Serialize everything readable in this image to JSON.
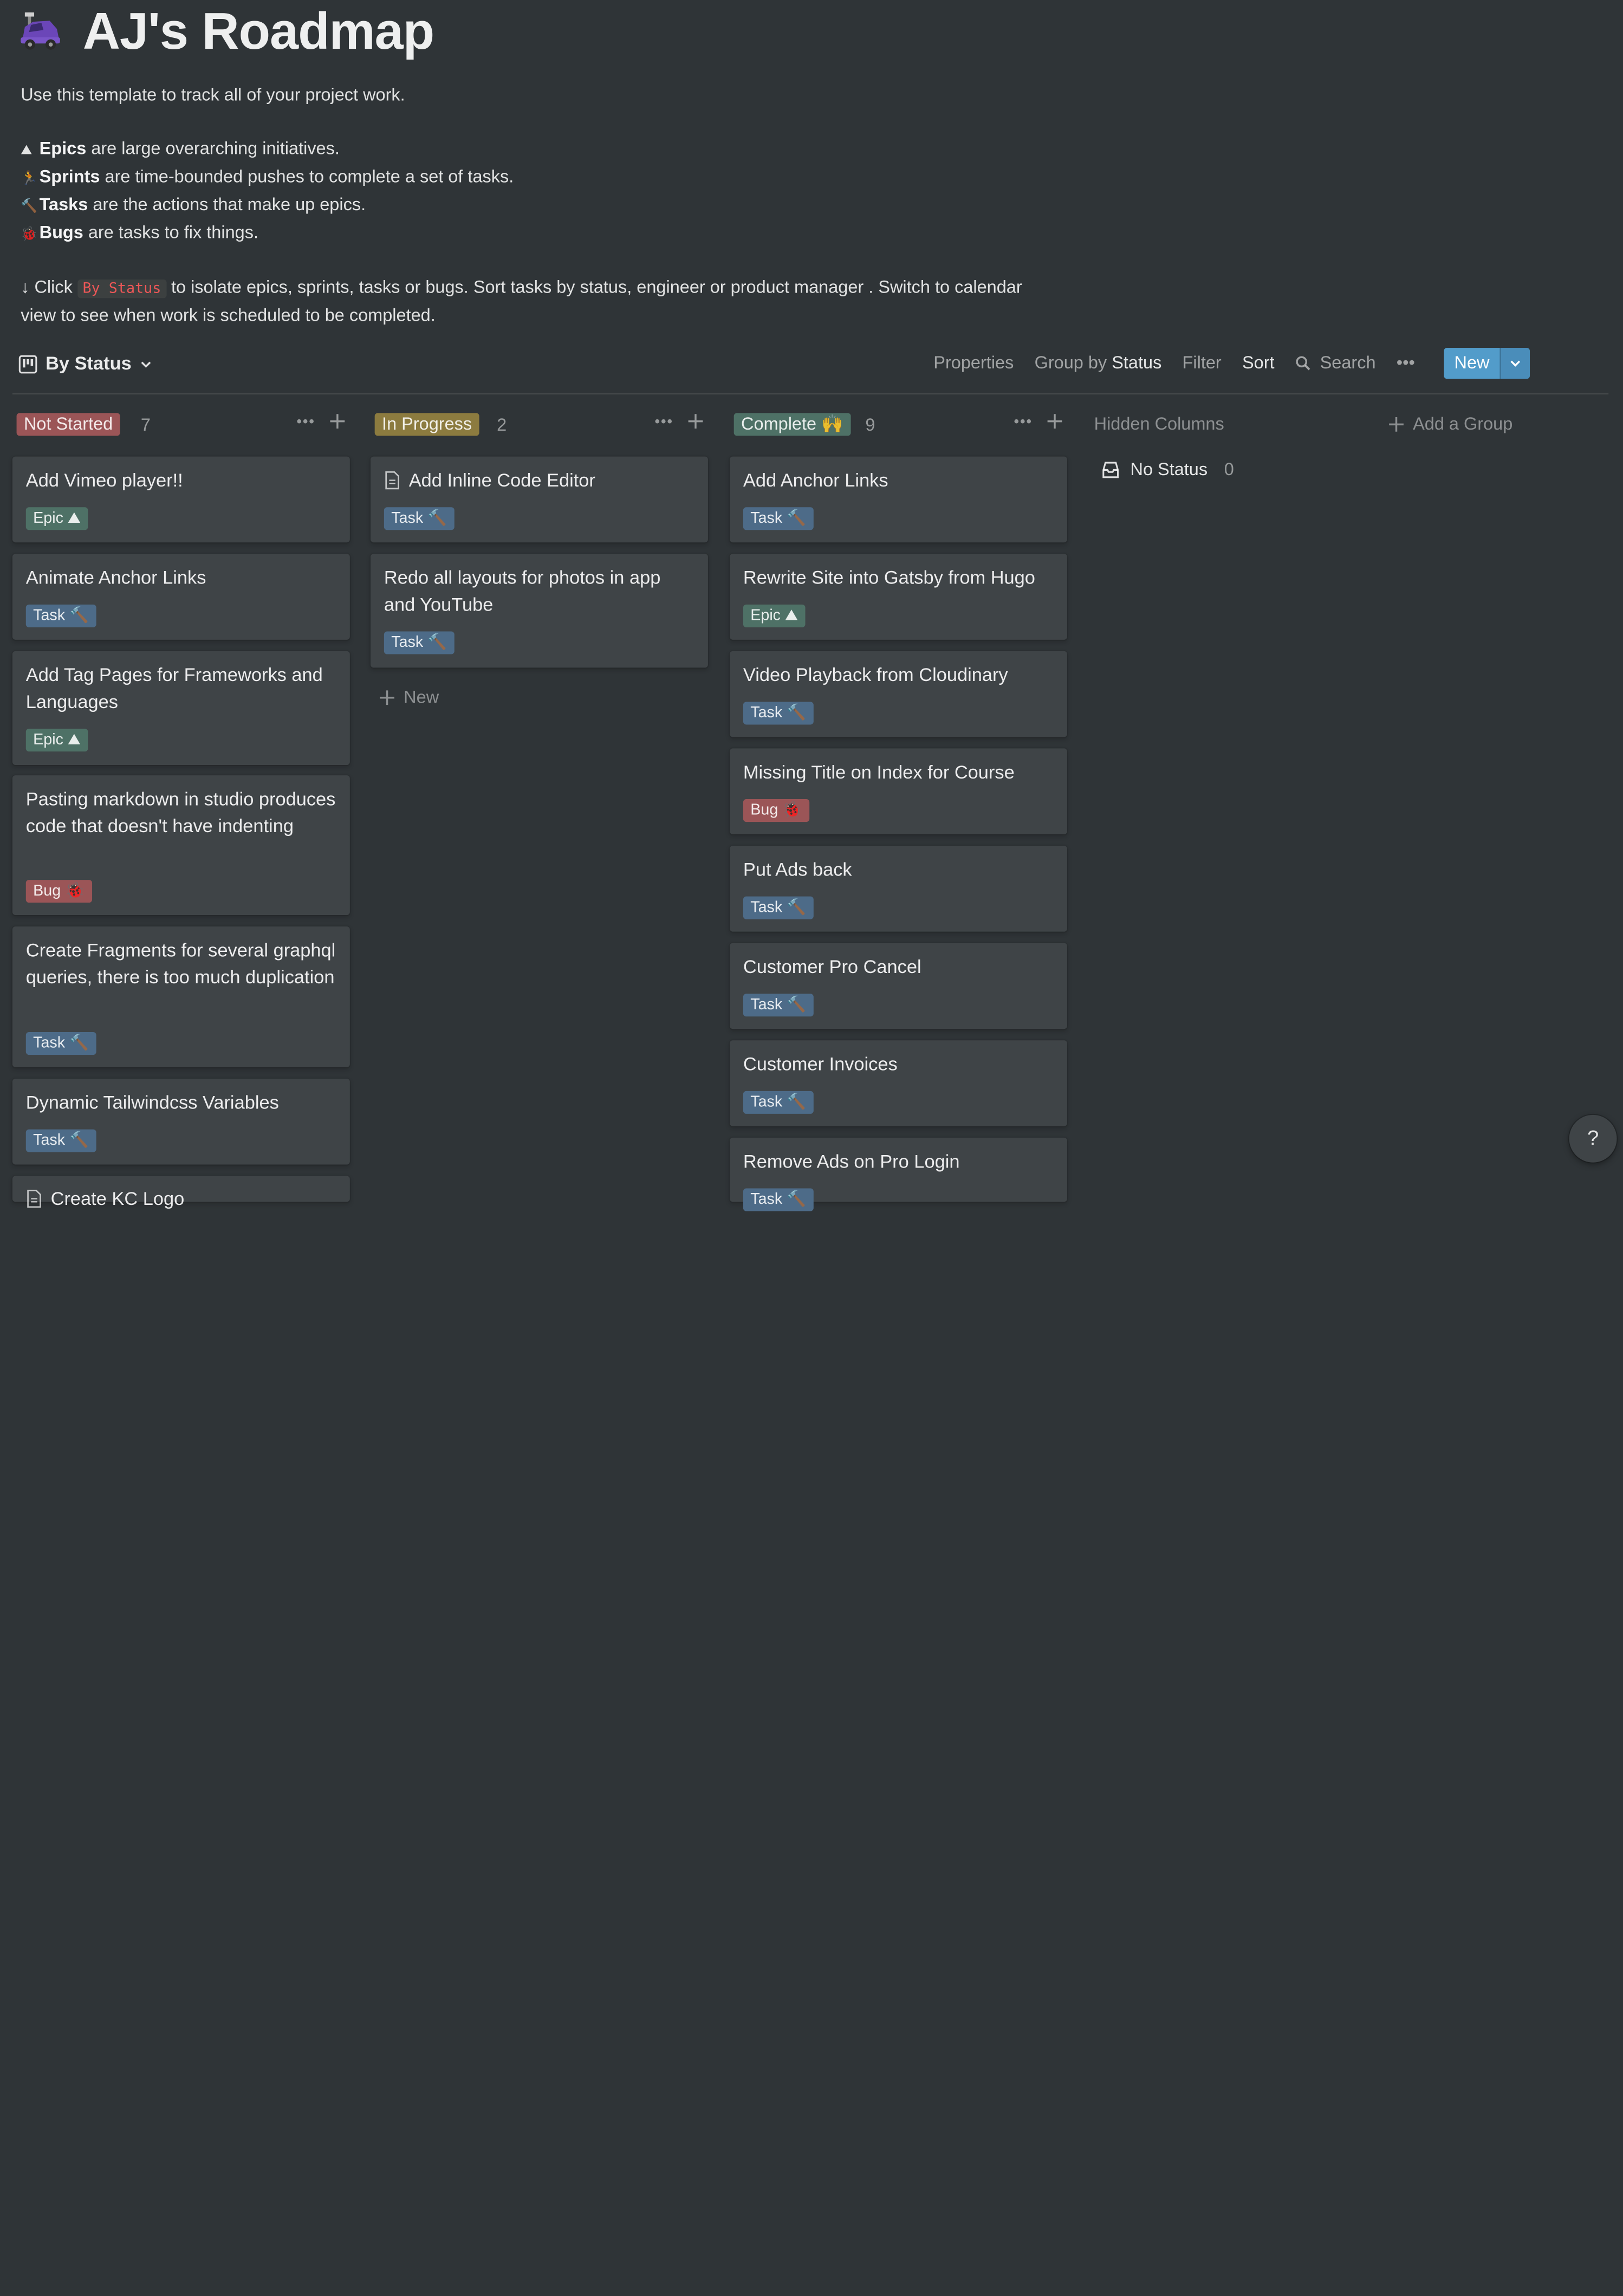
{
  "page": {
    "icon": "purple-car-icon",
    "title": "AJ's Roadmap",
    "intro": "Use this template to track all of your project work.",
    "legend": [
      {
        "icon": "mountain-icon",
        "emoji": "⛰",
        "term": "Epics",
        "rest": " are large overarching initiatives."
      },
      {
        "icon": "runner-icon",
        "emoji": "🏃",
        "term": "Sprints",
        "rest": " are time-bounded pushes to complete a set of tasks."
      },
      {
        "icon": "hammer-icon",
        "emoji": "🔨",
        "term": "Tasks",
        "rest": " are the actions that make up epics."
      },
      {
        "icon": "bug-icon",
        "emoji": "🐞",
        "term": "Bugs",
        "rest": " are tasks to fix things."
      }
    ],
    "hint": {
      "arrow": "↓",
      "before": " Click ",
      "code": "By Status",
      "after": " to isolate epics, sprints, tasks or bugs. Sort tasks by status, engineer or product manager . Switch to calendar view to see when work is scheduled to be completed."
    }
  },
  "toolbar": {
    "view_label": "By Status",
    "properties": "Properties",
    "group_by_prefix": "Group by",
    "group_by_value": "Status",
    "filter": "Filter",
    "sort": "Sort",
    "search": "Search",
    "more": "•••",
    "new_label": "New"
  },
  "columns": [
    {
      "name": "Not Started",
      "count": "7",
      "color": "#9b5557",
      "cards": [
        {
          "title": "Add Vimeo player!!",
          "tag": "Epic ⛰"
        },
        {
          "title": "Animate Anchor Links",
          "tag": "Task 🔨"
        },
        {
          "title": "Add Tag Pages for Frameworks and Languages",
          "tag": "Epic ⛰"
        },
        {
          "title": "Pasting markdown in studio produces code that doesn't have indenting",
          "tag": "Bug 🐞"
        },
        {
          "title": "Create Fragments for several graphql queries, there is too much duplication",
          "tag": "Task 🔨"
        },
        {
          "title": "Dynamic Tailwindcss Variables",
          "tag": "Task 🔨"
        },
        {
          "title": "Create KC Logo"
        }
      ]
    },
    {
      "name": "In Progress",
      "count": "2",
      "color": "#8c7b3f",
      "cards": [
        {
          "title": "Add Inline Code Editor",
          "tag": "Task 🔨"
        },
        {
          "title": "Redo all layouts for photos in app and YouTube",
          "tag": "Task 🔨"
        }
      ],
      "new_label": "New"
    },
    {
      "name": "Complete 🙌",
      "count": "9",
      "color": "#4e7166",
      "cards": [
        {
          "title": "Add Anchor Links",
          "tag": "Task 🔨"
        },
        {
          "title": "Rewrite Site into Gatsby from Hugo",
          "tag": "Epic ⛰"
        },
        {
          "title": "Video Playback from Cloudinary",
          "tag": "Task 🔨"
        },
        {
          "title": "Missing Title on Index for Course",
          "tag": "Bug 🐞"
        },
        {
          "title": "Put Ads back",
          "tag": "Task 🔨"
        },
        {
          "title": "Customer Pro Cancel",
          "tag": "Task 🔨"
        },
        {
          "title": "Customer Invoices",
          "tag": "Task 🔨"
        },
        {
          "title": "Remove Ads on Pro Login",
          "tag": "Task 🔨"
        }
      ]
    }
  ],
  "hidden_columns": {
    "label": "Hidden Columns",
    "no_status": "No Status",
    "no_status_count": "0"
  },
  "add_group": "Add a Group",
  "help": "?"
}
